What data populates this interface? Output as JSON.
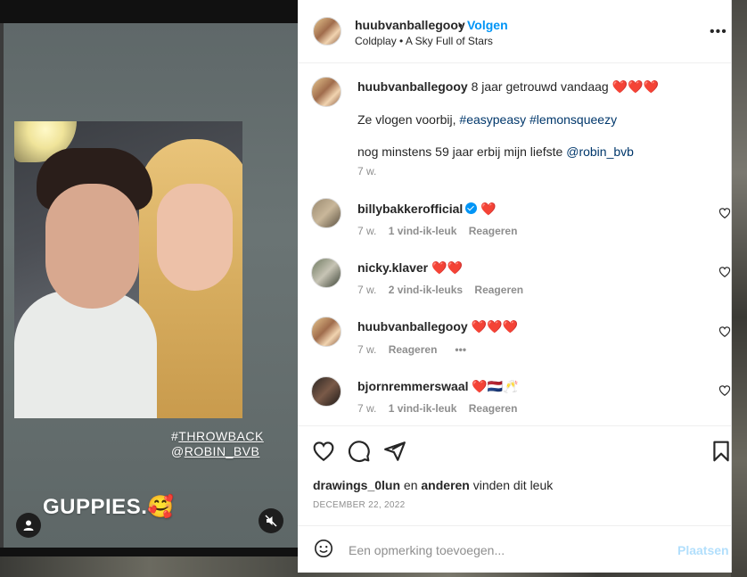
{
  "story": {
    "tag_line1_prefix": "#",
    "tag_line1_word": "THROWBACK",
    "tag_line2_prefix": "@",
    "tag_line2_word": "ROBIN_BVB",
    "caption": "GUPPIES.🥰"
  },
  "header": {
    "username": "huubvanballegooy",
    "dot": "•",
    "follow_label": "Volgen",
    "subtitle": "Coldplay • A Sky Full of Stars",
    "more": "•••"
  },
  "caption": {
    "username": "huubvanballegooy",
    "line1": "8 jaar getrouwd vandaag ❤️❤️❤️",
    "line2_text": "Ze vlogen voorbij, ",
    "line2_tag1": "#easypeasy",
    "line2_space": " ",
    "line2_tag2": "#lemonsqueezy",
    "line3_text": "nog minstens 59 jaar erbij mijn liefste ",
    "line3_mention": "@robin_bvb",
    "age": "7 w."
  },
  "comments": [
    {
      "username": "billybakkerofficial",
      "text": "❤️",
      "age": "7 w.",
      "likes": "1 vind-ik-leuk",
      "reply": "Reageren"
    },
    {
      "username": "nicky.klaver",
      "text": "❤️❤️",
      "age": "7 w.",
      "likes": "2 vind-ik-leuks",
      "reply": "Reageren"
    },
    {
      "username": "huubvanballegooy",
      "text": "❤️❤️❤️",
      "age": "7 w.",
      "likes": "",
      "reply": "Reageren",
      "more": "•••"
    },
    {
      "username": "bjornremmerswaal",
      "text": "❤️🇳🇱🥂",
      "age": "7 w.",
      "likes": "1 vind-ik-leuk",
      "reply": "Reageren"
    }
  ],
  "likes": {
    "user1": "drawings_0lun",
    "middle": " en ",
    "user2": "anderen",
    "suffix": " vinden dit leuk"
  },
  "date": "DECEMBER 22, 2022",
  "comment_box": {
    "placeholder": "Een opmerking toevoegen...",
    "post_label": "Plaatsen"
  },
  "colors": {
    "accent": "#0095f6",
    "link": "#00376b",
    "post_disabled": "#b2dffc"
  }
}
